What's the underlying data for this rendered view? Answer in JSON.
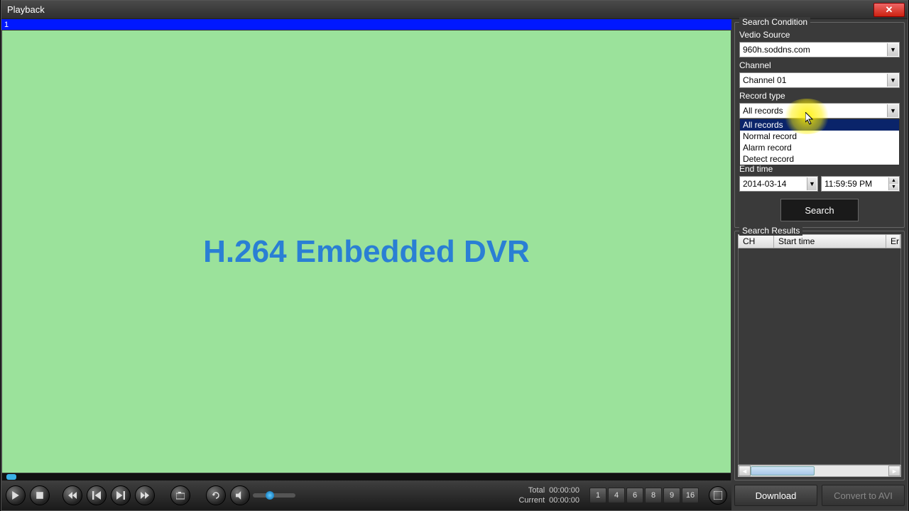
{
  "window": {
    "title": "Playback",
    "close": "✕"
  },
  "video": {
    "channel_label": "1",
    "overlay_text": "H.264 Embedded DVR"
  },
  "time": {
    "total_label": "Total",
    "total_value": "00:00:00",
    "current_label": "Current",
    "current_value": "00:00:00"
  },
  "grid_buttons": [
    "1",
    "4",
    "6",
    "8",
    "9",
    "16"
  ],
  "search": {
    "group_title": "Search Condition",
    "video_source_label": "Vedio Source",
    "video_source_value": "960h.soddns.com",
    "channel_label": "Channel",
    "channel_value": "Channel 01",
    "record_type_label": "Record type",
    "record_type_value": "All records",
    "record_type_options": [
      "All records",
      "Normal record",
      "Alarm record",
      "Detect record"
    ],
    "end_time_label": "End time",
    "end_date_value": "2014-03-14",
    "end_time_value": "11:59:59 PM",
    "search_button": "Search"
  },
  "results": {
    "group_title": "Search Results",
    "col_ch": "CH",
    "col_start": "Start time",
    "col_end": "Er"
  },
  "buttons": {
    "download": "Download",
    "convert": "Convert to AVI"
  }
}
